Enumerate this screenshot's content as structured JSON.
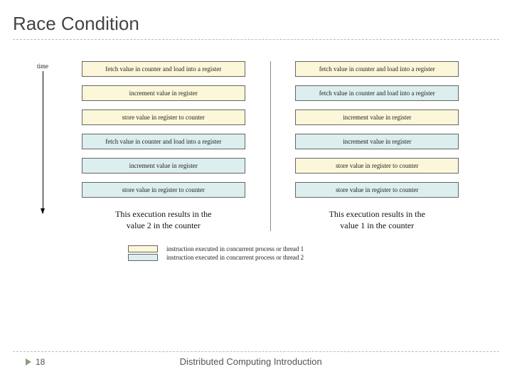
{
  "title": "Race Condition",
  "time_label": "time",
  "columns": {
    "left": {
      "steps": [
        {
          "text": "fetch value in counter and load into a register",
          "thread": 1
        },
        {
          "text": "increment value in register",
          "thread": 1
        },
        {
          "text": "store value in register to counter",
          "thread": 1
        },
        {
          "text": "fetch value in counter and load into a register",
          "thread": 2
        },
        {
          "text": "increment value in register",
          "thread": 2
        },
        {
          "text": "store value in register to counter",
          "thread": 2
        }
      ],
      "caption_line1": "This execution results in the",
      "caption_line2": "value 2 in the counter"
    },
    "right": {
      "steps": [
        {
          "text": "fetch value in counter and load into a register",
          "thread": 1
        },
        {
          "text": "fetch value in counter and load into a register",
          "thread": 2
        },
        {
          "text": "increment value in register",
          "thread": 1
        },
        {
          "text": "increment value in register",
          "thread": 2
        },
        {
          "text": "store value in register to counter",
          "thread": 1
        },
        {
          "text": "store value in register to counter",
          "thread": 2
        }
      ],
      "caption_line1": "This execution results in the",
      "caption_line2": "value 1 in the counter"
    }
  },
  "legend": {
    "thread1": "instruction executed in concurrent process or thread 1",
    "thread2": "instruction executed in concurrent process or thread 2"
  },
  "footer": {
    "page": "18",
    "title": "Distributed Computing Introduction"
  }
}
